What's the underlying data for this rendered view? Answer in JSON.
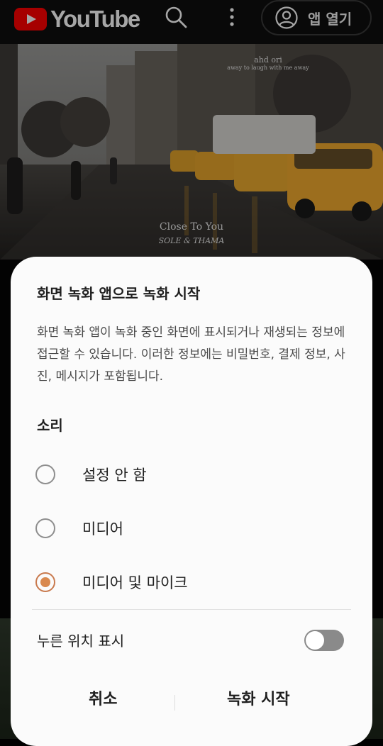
{
  "topbar": {
    "brand": "YouTube",
    "open_app_label": "앱 열기"
  },
  "video": {
    "watermark_top_line1": "ahd ori",
    "watermark_top_line2": "away to laugh with me away",
    "caption_line1": "Close To You",
    "caption_line2": "SOLE & THAMA"
  },
  "dialog": {
    "title": "화면 녹화 앱으로 녹화 시작",
    "description": "화면 녹화 앱이 녹화 중인 화면에 표시되거나 재생되는 정보에 접근할 수 있습니다. 이러한 정보에는 비밀번호, 결제 정보, 사진, 메시지가 포함됩니다.",
    "sound_heading": "소리",
    "options": [
      {
        "label": "설정 안 함",
        "selected": false
      },
      {
        "label": "미디어",
        "selected": false
      },
      {
        "label": "미디어 및 마이크",
        "selected": true
      }
    ],
    "show_touches_label": "누른 위치 표시",
    "show_touches_on": false,
    "cancel_label": "취소",
    "start_label": "녹화 시작"
  },
  "colors": {
    "radio_selected": "#d9894f",
    "brand_red": "#ff0000"
  }
}
